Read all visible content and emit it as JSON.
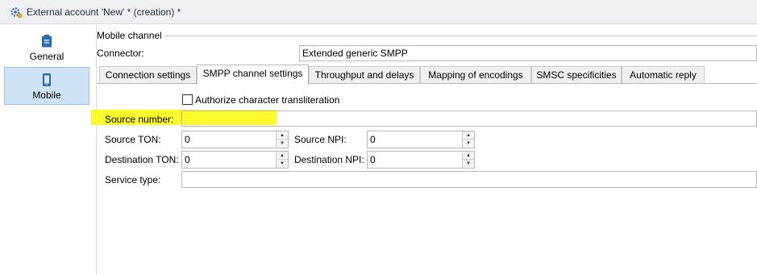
{
  "window": {
    "title": "External account 'New' * (creation) *",
    "icon": "gear-icon"
  },
  "nav": {
    "items": [
      {
        "label": "General",
        "icon": "clipboard-icon",
        "active": false
      },
      {
        "label": "Mobile",
        "icon": "mobile-phone-icon",
        "active": true
      }
    ]
  },
  "section": {
    "group_label": "Mobile channel",
    "connector_label": "Connector:",
    "connector_value": "Extended generic SMPP"
  },
  "tabs": [
    {
      "label": "Connection settings",
      "active": false
    },
    {
      "label": "SMPP channel settings",
      "active": true
    },
    {
      "label": "Throughput and delays",
      "active": false
    },
    {
      "label": "Mapping of encodings",
      "active": false
    },
    {
      "label": "SMSC specificities",
      "active": false
    },
    {
      "label": "Automatic reply",
      "active": false
    }
  ],
  "smpp": {
    "transliteration_label": "Authorize character transliteration",
    "transliteration_checked": false,
    "source_number_label": "Source number:",
    "source_number_value": "",
    "source_ton_label": "Source TON:",
    "source_ton_value": "0",
    "source_npi_label": "Source NPI:",
    "source_npi_value": "0",
    "dest_ton_label": "Destination TON:",
    "dest_ton_value": "0",
    "dest_npi_label": "Destination NPI:",
    "dest_npi_value": "0",
    "service_type_label": "Service type:",
    "service_type_value": ""
  },
  "colors": {
    "highlight": "#fbfb2c",
    "nav_active": "#cfe3f7",
    "titlebar": "#eef0f3"
  }
}
